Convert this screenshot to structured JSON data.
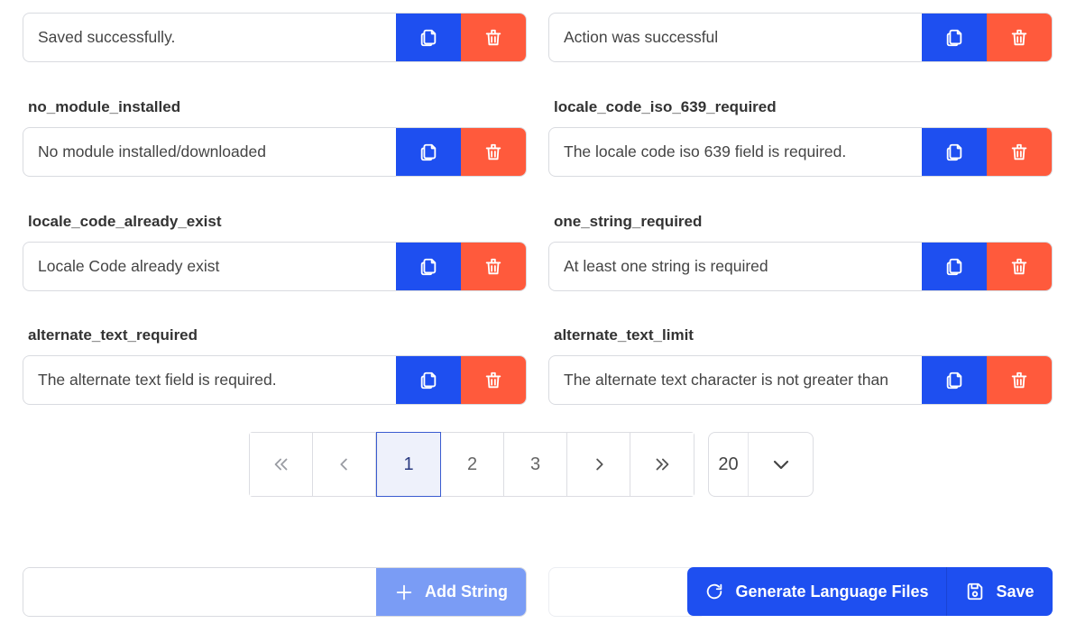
{
  "rows": [
    {
      "left": {
        "key": "",
        "value": "Saved successfully."
      },
      "right": {
        "key": "",
        "value": "Action was successful"
      }
    },
    {
      "left": {
        "key": "no_module_installed",
        "value": "No module installed/downloaded"
      },
      "right": {
        "key": "locale_code_iso_639_required",
        "value": "The locale code iso 639 field is required."
      }
    },
    {
      "left": {
        "key": "locale_code_already_exist",
        "value": "Locale Code already exist"
      },
      "right": {
        "key": "one_string_required",
        "value": "At least one string is required"
      }
    },
    {
      "left": {
        "key": "alternate_text_required",
        "value": "The alternate text field is required."
      },
      "right": {
        "key": "alternate_text_limit",
        "value": "The alternate text character is not greater than"
      }
    }
  ],
  "icons": {
    "copy": "copy-icon",
    "delete": "trash-icon"
  },
  "colors": {
    "primary": "#1e4ff0",
    "danger": "#ff5a3c",
    "primary_light": "#7a9cf5"
  },
  "pagination": {
    "pages": [
      "1",
      "2",
      "3"
    ],
    "current": "1",
    "per_page": "20"
  },
  "footer": {
    "new_string_placeholder": "",
    "add_string_label": "Add String",
    "generate_label": "Generate Language Files",
    "save_label": "Save"
  }
}
